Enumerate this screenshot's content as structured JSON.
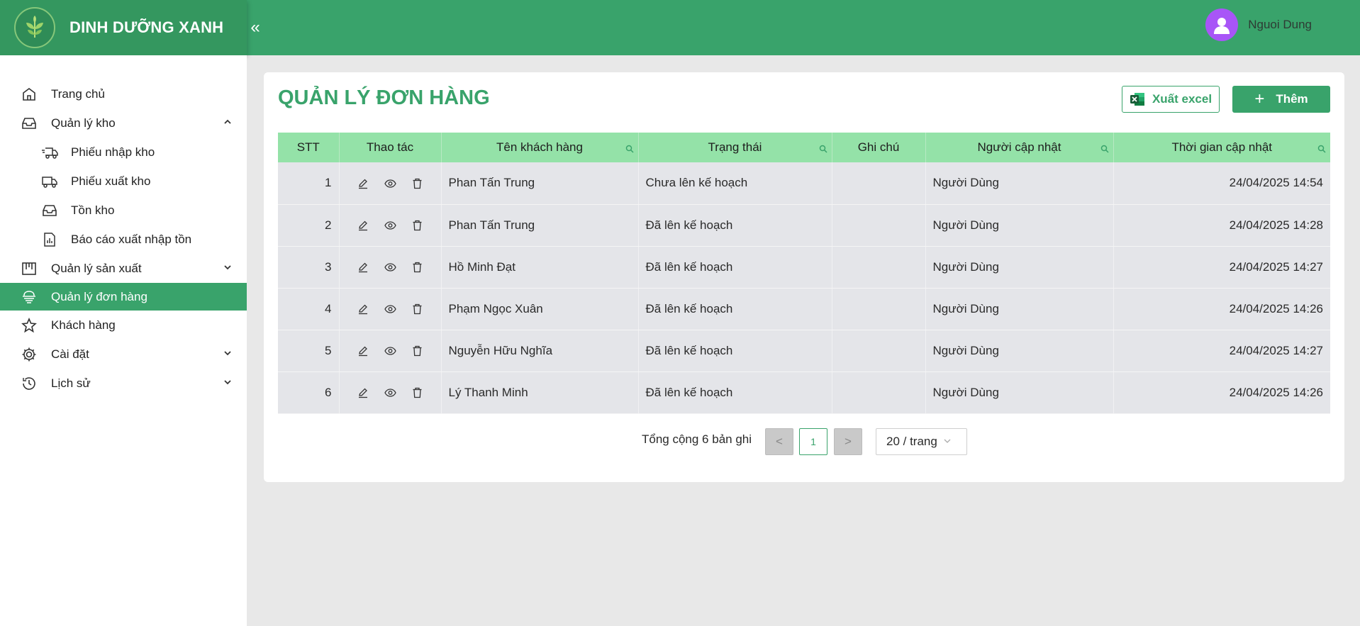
{
  "brand": {
    "name": "DINH DƯỠNG XANH"
  },
  "header": {
    "collapse_symbol": "«",
    "user_name": "Nguoi Dung"
  },
  "sidebar": {
    "items": [
      {
        "label": "Trang chủ",
        "icon": "home-icon"
      },
      {
        "label": "Quản lý kho",
        "icon": "inbox-icon",
        "expanded": true,
        "children": [
          {
            "label": "Phiếu nhập kho",
            "icon": "truck-in-icon"
          },
          {
            "label": "Phiếu xuất kho",
            "icon": "truck-out-icon"
          },
          {
            "label": "Tồn kho",
            "icon": "inbox-icon"
          },
          {
            "label": "Báo cáo xuất nhập tồn",
            "icon": "report-icon"
          }
        ]
      },
      {
        "label": "Quản lý sản xuất",
        "icon": "factory-icon",
        "expanded": false
      },
      {
        "label": "Quản lý đơn hàng",
        "icon": "order-icon",
        "active": true
      },
      {
        "label": "Khách hàng",
        "icon": "star-icon"
      },
      {
        "label": "Cài đặt",
        "icon": "gear-icon",
        "expanded": false
      },
      {
        "label": "Lịch sử",
        "icon": "history-icon",
        "expanded": false
      }
    ]
  },
  "main": {
    "title": "QUẢN LÝ ĐƠN HÀNG",
    "export_label": "Xuất excel",
    "add_label": "Thêm",
    "columns": [
      "STT",
      "Thao tác",
      "Tên khách hàng",
      "Trạng thái",
      "Ghi chú",
      "Người cập nhật",
      "Thời gian cập nhật"
    ],
    "rows": [
      {
        "stt": "1",
        "customer": "Phan Tấn Trung",
        "status": "Chưa lên kế hoạch",
        "note": "",
        "updated_by": "Người Dùng",
        "updated_at": "24/04/2025 14:54"
      },
      {
        "stt": "2",
        "customer": "Phan Tấn Trung",
        "status": "Đã lên kế hoạch",
        "note": "",
        "updated_by": "Người Dùng",
        "updated_at": "24/04/2025 14:28"
      },
      {
        "stt": "3",
        "customer": "Hồ Minh Đạt",
        "status": "Đã lên kế hoạch",
        "note": "",
        "updated_by": "Người Dùng",
        "updated_at": "24/04/2025 14:27"
      },
      {
        "stt": "4",
        "customer": "Phạm Ngọc Xuân",
        "status": "Đã lên kế hoạch",
        "note": "",
        "updated_by": "Người Dùng",
        "updated_at": "24/04/2025 14:26"
      },
      {
        "stt": "5",
        "customer": "Nguyễn Hữu Nghĩa",
        "status": "Đã lên kế hoạch",
        "note": "",
        "updated_by": "Người Dùng",
        "updated_at": "24/04/2025 14:27"
      },
      {
        "stt": "6",
        "customer": "Lý Thanh Minh",
        "status": "Đã lên kế hoạch",
        "note": "",
        "updated_by": "Người Dùng",
        "updated_at": "24/04/2025 14:26"
      }
    ],
    "pagination": {
      "total_text": "Tổng cộng 6 bản ghi",
      "current_page": "1",
      "page_size": "20 / trang",
      "prev_symbol": "<",
      "next_symbol": ">"
    }
  },
  "colors": {
    "primary": "#39a36b",
    "header_cell": "#94e2a8",
    "row": "#e4e5e9",
    "avatar": "#a855f7"
  }
}
